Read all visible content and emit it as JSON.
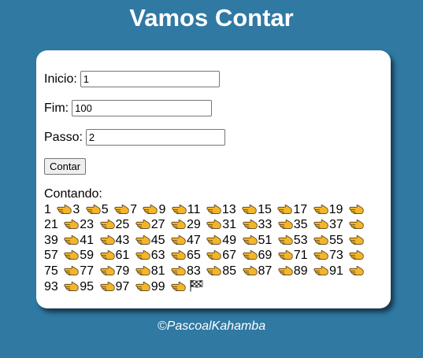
{
  "page": {
    "title": "Vamos Contar",
    "footer": "©PascoalKahamba",
    "background_color": "#3079a3",
    "card_color": "#ffffff"
  },
  "form": {
    "inicio_label": "Inicio:",
    "inicio_value": "1",
    "fim_label": "Fim:",
    "fim_value": "100",
    "passo_label": "Passo:",
    "passo_value": "2",
    "button_label": "Contar"
  },
  "result": {
    "heading": "Contando:",
    "numbers": [
      1,
      3,
      5,
      7,
      9,
      11,
      13,
      15,
      17,
      19,
      21,
      23,
      25,
      27,
      29,
      31,
      33,
      35,
      37,
      39,
      41,
      43,
      45,
      47,
      49,
      51,
      53,
      55,
      57,
      59,
      61,
      63,
      65,
      67,
      69,
      71,
      73,
      75,
      77,
      79,
      81,
      83,
      85,
      87,
      89,
      91,
      93,
      95,
      97,
      99
    ],
    "separator_icon": "pointing-hand-icon",
    "end_icon": "checkered-flag-icon"
  }
}
